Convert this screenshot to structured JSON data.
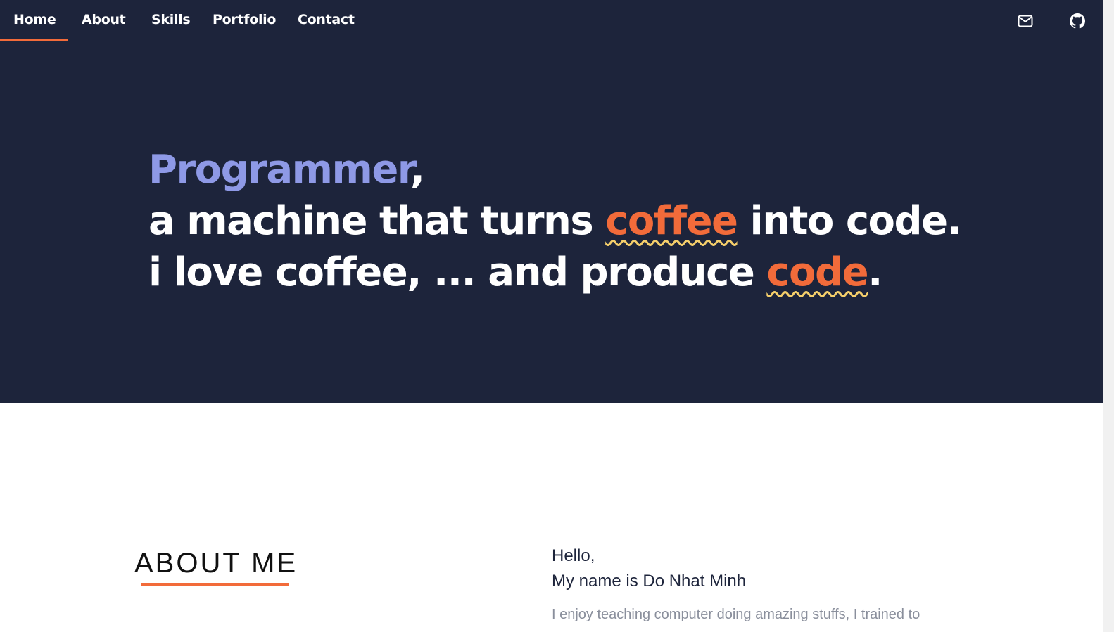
{
  "nav": {
    "items": [
      {
        "label": "Home",
        "active": true
      },
      {
        "label": "About"
      },
      {
        "label": "Skills"
      },
      {
        "label": "Portfolio"
      },
      {
        "label": "Contact"
      }
    ],
    "icons": [
      "mail-icon",
      "github-icon"
    ]
  },
  "hero": {
    "line1_word": "Programmer",
    "line1_tail": ",",
    "line2_a": "a machine that turns ",
    "line2_b": "coffee",
    "line2_c": " into code.",
    "line3_a": "i love coffee, ... and produce ",
    "line3_b": "code",
    "line3_c": "."
  },
  "about": {
    "title": "ABOUT ME",
    "hello": "Hello,",
    "name_line": "My name is Do Nhat Minh",
    "description": "I enjoy teaching computer doing amazing stuffs, I trained to"
  },
  "colors": {
    "hero_bg": "#1d243b",
    "accent_orange": "#f26b3a",
    "accent_blue": "#8e99e6",
    "wavy_yellow": "#f5cf6b"
  }
}
